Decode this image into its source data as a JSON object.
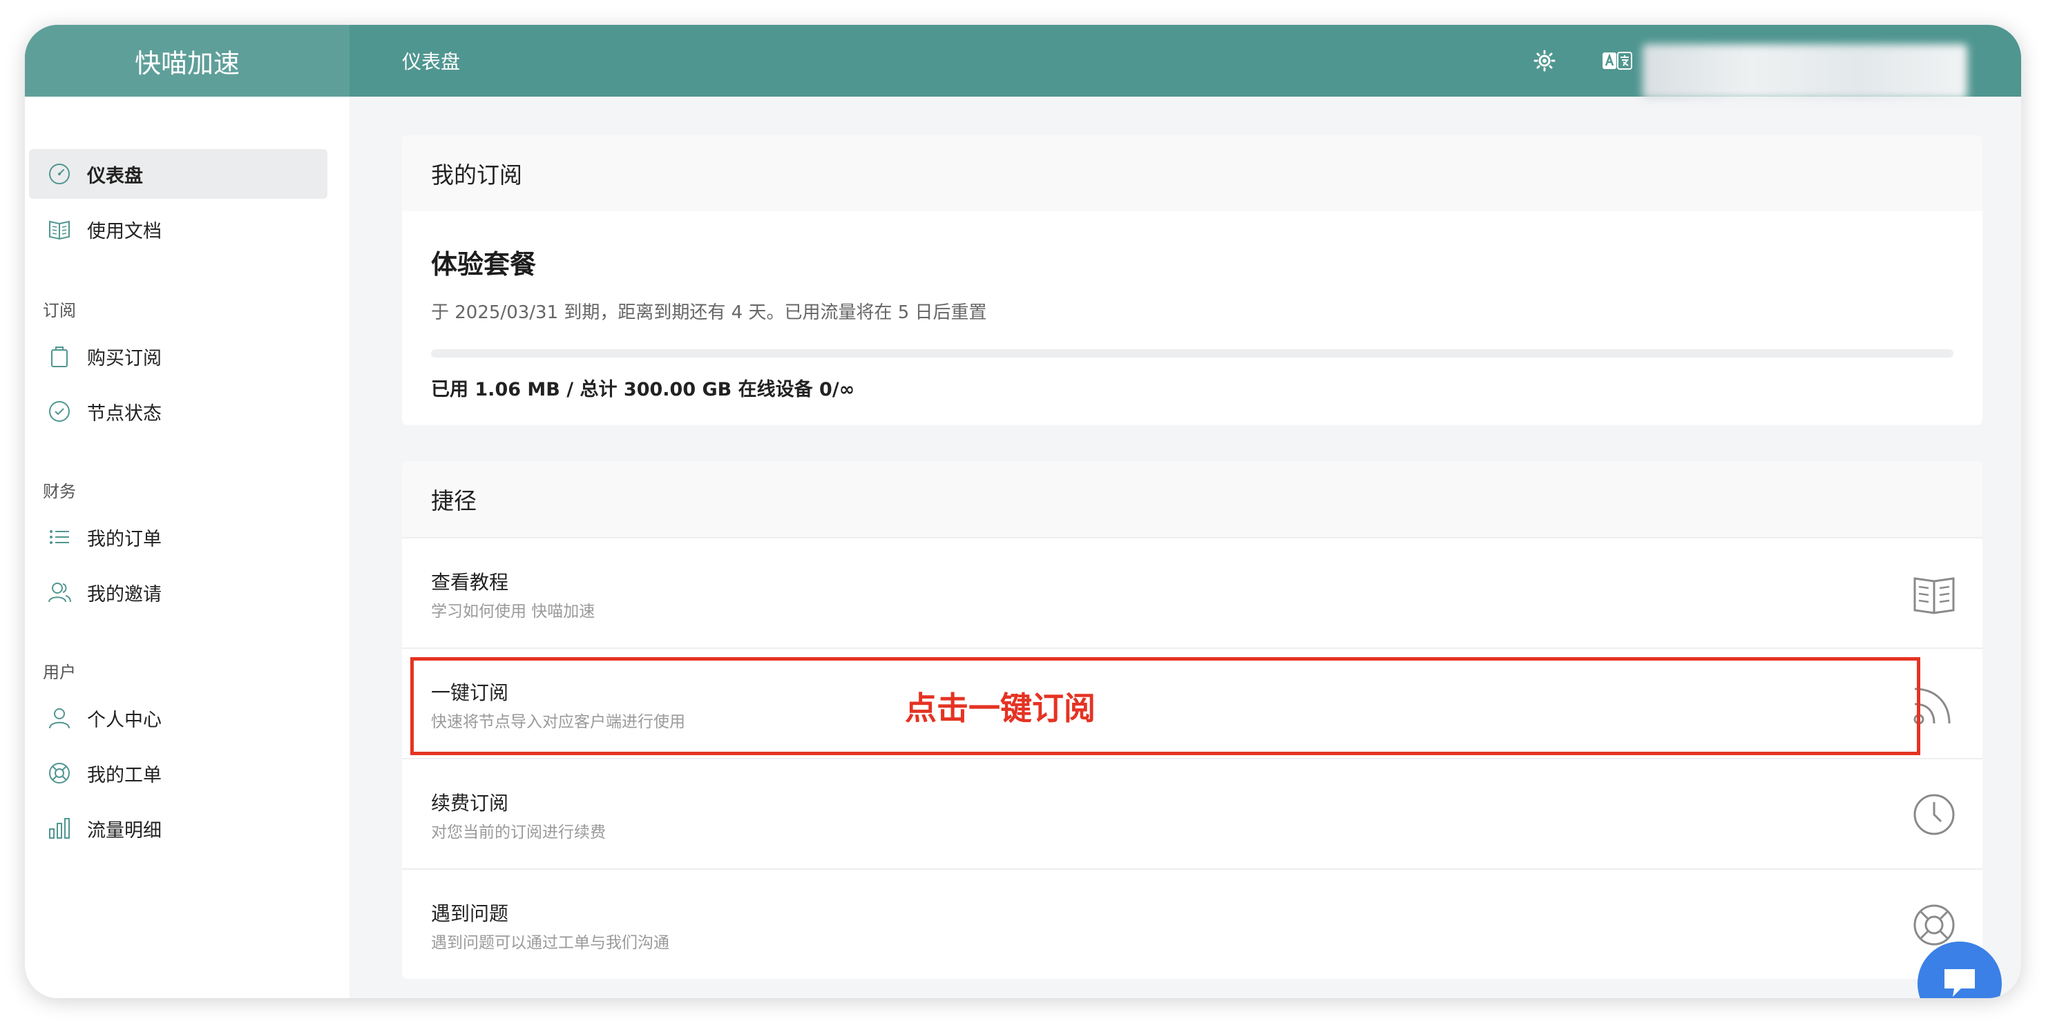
{
  "app": {
    "brand": "快喵加速",
    "page_title": "仪表盘"
  },
  "sidebar": {
    "items_top": [
      {
        "label": "仪表盘",
        "icon": "dashboard-icon",
        "active": true
      },
      {
        "label": "使用文档",
        "icon": "book-icon"
      }
    ],
    "groups": [
      {
        "label": "订阅",
        "items": [
          {
            "label": "购买订阅",
            "icon": "shopping-bag-icon"
          },
          {
            "label": "节点状态",
            "icon": "check-circle-icon"
          }
        ]
      },
      {
        "label": "财务",
        "items": [
          {
            "label": "我的订单",
            "icon": "list-icon"
          },
          {
            "label": "我的邀请",
            "icon": "users-icon"
          }
        ]
      },
      {
        "label": "用户",
        "items": [
          {
            "label": "个人中心",
            "icon": "user-icon"
          },
          {
            "label": "我的工单",
            "icon": "lifebuoy-icon"
          },
          {
            "label": "流量明细",
            "icon": "bar-chart-icon"
          }
        ]
      }
    ]
  },
  "subscription": {
    "header": "我的订阅",
    "plan_name": "体验套餐",
    "description": "于 2025/03/31 到期，距离到期还有 4 天。已用流量将在 5 日后重置",
    "usage": "已用 1.06 MB / 总计 300.00 GB 在线设备 0/∞",
    "progress_fraction": 0.0
  },
  "shortcuts": {
    "header": "捷径",
    "items": [
      {
        "title": "查看教程",
        "desc": "学习如何使用 快喵加速",
        "icon": "book-icon"
      },
      {
        "title": "一键订阅",
        "desc": "快速将节点导入对应客户端进行使用",
        "icon": "rss-icon"
      },
      {
        "title": "续费订阅",
        "desc": "对您当前的订阅进行续费",
        "icon": "clock-icon"
      },
      {
        "title": "遇到问题",
        "desc": "遇到问题可以通过工单与我们沟通",
        "icon": "lifebuoy-icon"
      }
    ]
  },
  "annotation": {
    "text": "点击一键订阅",
    "color": "#e53323"
  },
  "colors": {
    "header": "#509690",
    "brand_bg": "#5f9f9a",
    "accent": "#509690",
    "chat": "#3b80e6"
  }
}
